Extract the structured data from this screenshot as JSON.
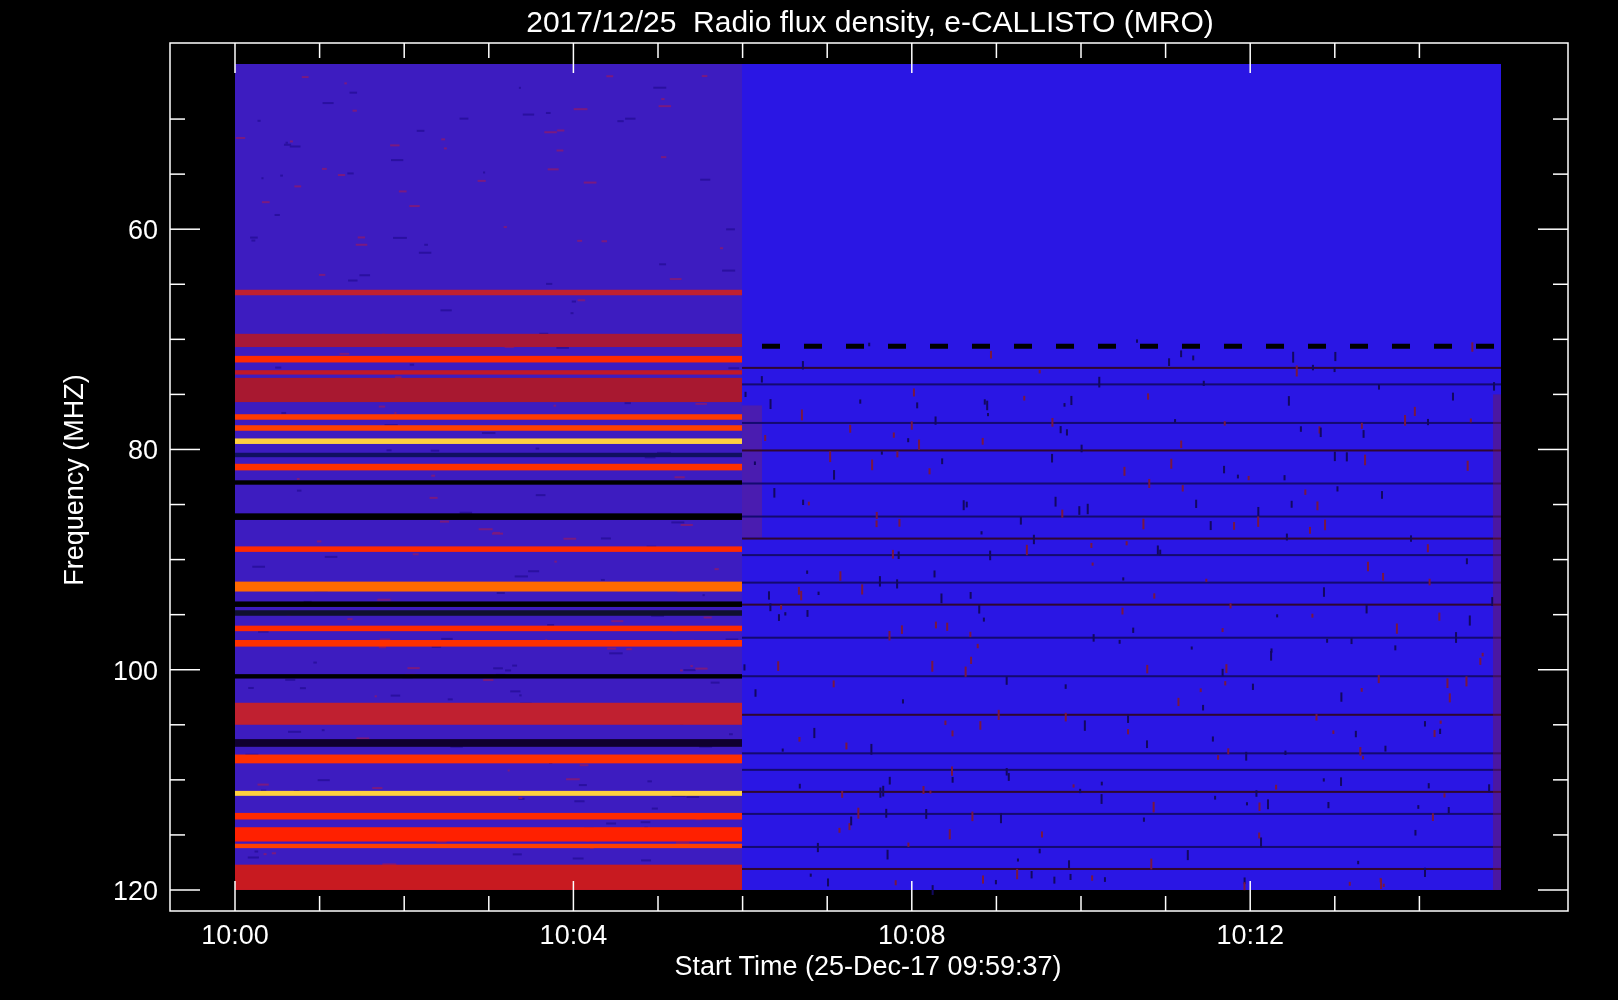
{
  "title": "2017/12/25  Radio flux density, e-CALLISTO (MRO)",
  "y_axis": {
    "label": "Frequency (MHZ)",
    "ticks": [
      "60",
      "80",
      "100",
      "120"
    ]
  },
  "x_axis": {
    "label": "Start Time (25-Dec-17 09:59:37)",
    "ticks": [
      "10:00",
      "10:04",
      "10:08",
      "10:12"
    ]
  }
}
